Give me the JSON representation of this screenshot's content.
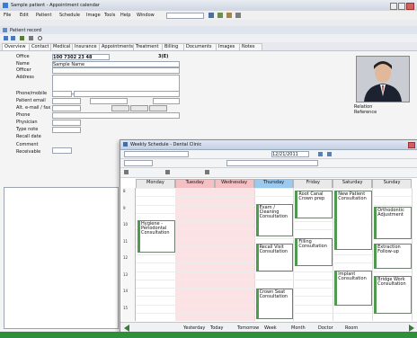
{
  "window": {
    "title": "Sample patient - Appointment calendar"
  },
  "menu": [
    "File",
    "Edit",
    "Patient",
    "Schedule",
    "Image",
    "Tools",
    "Help",
    "Window"
  ],
  "inner_window": {
    "title": "Patient record"
  },
  "tabs": [
    "Overview",
    "Contact",
    "Medical",
    "Insurance",
    "Appointments",
    "Treatment",
    "Billing",
    "Documents",
    "Images",
    "Notes"
  ],
  "patient": {
    "id_value": "100 7302 23 48",
    "id_suffix": "3(E)",
    "labels": [
      "Office",
      "Name",
      "Officer",
      "Address",
      "",
      "Phone/mobile",
      "Patient email",
      "Alt. e-mail / fax",
      "Phone",
      "Physician",
      "Type note",
      "Recall date",
      "Comment",
      "Receivable"
    ],
    "values": [
      "",
      "Sample Name",
      "",
      "",
      "",
      "",
      "",
      "",
      "",
      "",
      "",
      "",
      "",
      ""
    ],
    "side_labels": [
      "Relation",
      "Reference"
    ]
  },
  "calendar": {
    "title": "Weekly Schedule - Dental Clinic",
    "date_range": "12/21/2011",
    "days": [
      "Monday",
      "Tuesday",
      "Wednesday",
      "Thursday",
      "Friday",
      "Saturday",
      "Sunday"
    ],
    "times": [
      "8",
      "9",
      "10",
      "11",
      "12",
      "13",
      "14",
      "15"
    ],
    "appointments": [
      {
        "day": 0,
        "start": 0.24,
        "end": 0.48,
        "title": "Hygiene - Periodontal",
        "note": "Consultation"
      },
      {
        "day": 3,
        "start": 0.12,
        "end": 0.36,
        "title": "Exam / Cleaning",
        "note": "Consultation"
      },
      {
        "day": 4,
        "start": 0.02,
        "end": 0.22,
        "title": "Root Canal",
        "note": "Crown prep"
      },
      {
        "day": 5,
        "start": 0.02,
        "end": 0.46,
        "title": "New Patient",
        "note": "Consultation"
      },
      {
        "day": 6,
        "start": 0.14,
        "end": 0.38,
        "title": "Orthodontic",
        "note": "Adjustment"
      },
      {
        "day": 3,
        "start": 0.42,
        "end": 0.62,
        "title": "Recall Visit",
        "note": "Consultation"
      },
      {
        "day": 4,
        "start": 0.38,
        "end": 0.58,
        "title": "Filling",
        "note": "Consultation"
      },
      {
        "day": 6,
        "start": 0.42,
        "end": 0.6,
        "title": "Extraction",
        "note": "Follow-up"
      },
      {
        "day": 5,
        "start": 0.62,
        "end": 0.88,
        "title": "Implant",
        "note": "Consultation"
      },
      {
        "day": 3,
        "start": 0.76,
        "end": 0.98,
        "title": "Crown Seat",
        "note": "Consultation"
      },
      {
        "day": 6,
        "start": 0.66,
        "end": 0.94,
        "title": "Bridge Work",
        "note": "Consultation"
      }
    ],
    "footer_items": [
      "Yesterday",
      "Today",
      "Tomorrow",
      "Week",
      "Month",
      "Doctor",
      "Room"
    ],
    "colors": {
      "weekend": "#f4c0c4",
      "today": "#9ec9ee",
      "header": "#e9e9e9",
      "appointment_border": "#4f9a4f"
    }
  },
  "status": {
    "text": ""
  }
}
